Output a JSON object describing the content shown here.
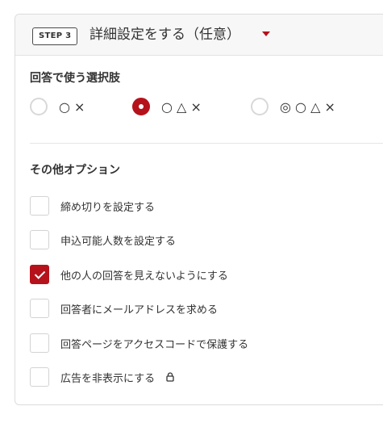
{
  "step": {
    "badge": "STEP 3",
    "title": "詳細設定をする（任意）"
  },
  "answer_choices": {
    "title": "回答で使う選択肢",
    "options": [
      {
        "label": "○ ×",
        "selected": false
      },
      {
        "label": "○ △ ×",
        "selected": true
      },
      {
        "label": "◎ ○ △ ×",
        "selected": false
      }
    ]
  },
  "other_options": {
    "title": "その他オプション",
    "items": [
      {
        "label": "締め切りを設定する",
        "checked": false
      },
      {
        "label": "申込可能人数を設定する",
        "checked": false
      },
      {
        "label": "他の人の回答を見えないようにする",
        "checked": true
      },
      {
        "label": "回答者にメールアドレスを求める",
        "checked": false
      },
      {
        "label": "回答ページをアクセスコードで保護する",
        "checked": false
      },
      {
        "label": "広告を非表示にする",
        "checked": false,
        "icon": "lock-icon"
      }
    ]
  },
  "colors": {
    "accent": "#b5121b",
    "border": "#dcdcdc"
  }
}
